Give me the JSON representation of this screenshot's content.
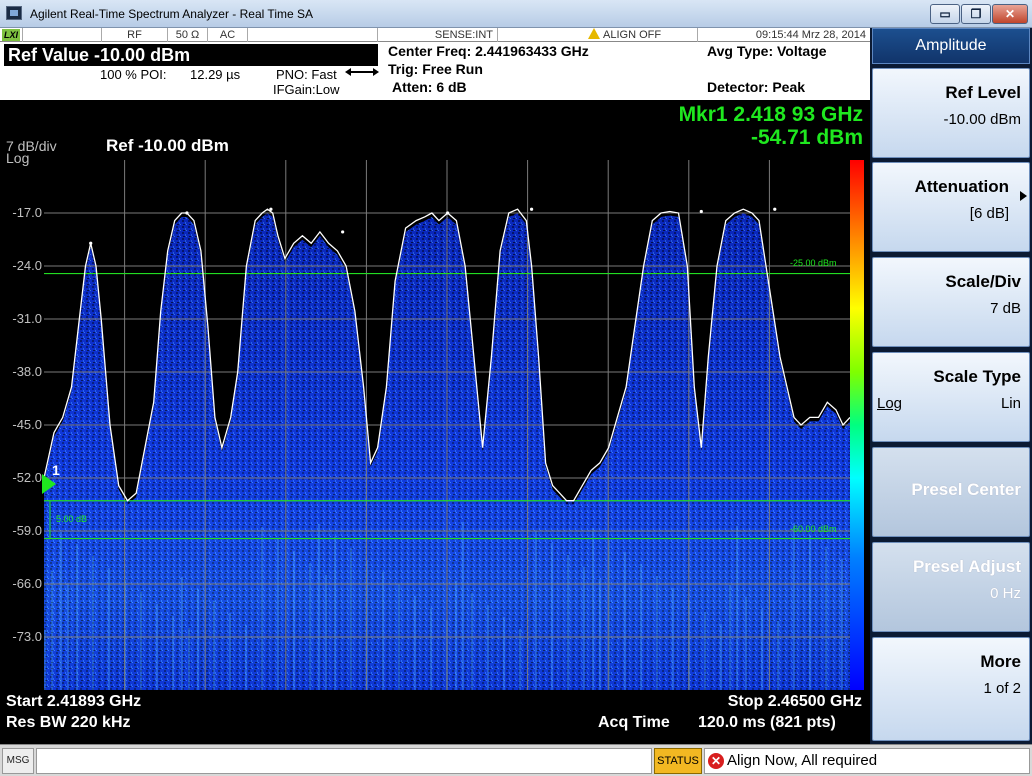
{
  "window": {
    "title": "Agilent Real-Time Spectrum Analyzer - Real Time SA",
    "min_glyph": "▭",
    "max_glyph": "❐",
    "close_glyph": "✕",
    "icon": "app-icon"
  },
  "status_row": {
    "lxi": "LXI",
    "rf": "RF",
    "impedance": "50 Ω",
    "coupling": "AC",
    "sense": "SENSE:INT",
    "align": "ALIGN OFF",
    "datetime": "09:15:44 Mrz 28, 2014"
  },
  "header": {
    "ref_value": "Ref Value -10.00 dBm",
    "poi_label": "100 % POI:",
    "poi_value": "12.29 µs",
    "pno": "PNO: Fast",
    "ifgain": "IFGain:Low",
    "center_freq": "Center Freq: 2.441963433 GHz",
    "trig": "Trig: Free Run",
    "atten": "Atten: 6 dB",
    "avg_type": "Avg Type: Voltage",
    "detector": "Detector: Peak"
  },
  "display": {
    "scale": "7 dB/div",
    "scale_type": "Log",
    "ref": "Ref -10.00 dBm",
    "marker_freq": "Mkr1 2.418 93 GHz",
    "marker_amp": "-54.71 dBm",
    "marker_label": "1",
    "y_labels": [
      "-17.0",
      "-24.0",
      "-31.0",
      "-38.0",
      "-45.0",
      "-52.0",
      "-59.0",
      "-66.0",
      "-73.0"
    ],
    "line_upper_label": "-25.00 dBm",
    "line_lower_label": "-60.00 dBm",
    "delta_label": "5.00 dB",
    "start": "Start 2.41893 GHz",
    "res_bw": "Res BW 220 kHz",
    "stop": "Stop 2.46500 GHz",
    "acq_label": "Acq Time",
    "acq_value": "120.0 ms (821 pts)"
  },
  "chart_data": {
    "type": "line",
    "xlabel": "",
    "ylabel": "",
    "xlim": [
      2.41893,
      2.465
    ],
    "ylim": [
      -80,
      -10
    ],
    "y_ticks": [
      -17,
      -24,
      -31,
      -38,
      -45,
      -52,
      -59,
      -66,
      -73
    ],
    "grid": true,
    "marker": {
      "x": 2.41893,
      "y": -54.71
    },
    "threshold_lines": [
      -25.0,
      -55.0,
      -60.0
    ],
    "peaks": [
      {
        "x": 2.4216,
        "y": -21.0
      },
      {
        "x": 2.4271,
        "y": -17.0
      },
      {
        "x": 2.4319,
        "y": -16.5
      },
      {
        "x": 2.436,
        "y": -19.5
      },
      {
        "x": 2.442,
        "y": -17.0
      },
      {
        "x": 2.4468,
        "y": -16.5
      },
      {
        "x": 2.4565,
        "y": -16.8
      },
      {
        "x": 2.4607,
        "y": -16.5
      }
    ],
    "trace": {
      "name": "",
      "x": [
        2.41893,
        2.4195,
        2.42,
        2.4205,
        2.421,
        2.4213,
        2.4216,
        2.4219,
        2.4222,
        2.4227,
        2.4232,
        2.4237,
        2.4242,
        2.4247,
        2.4252,
        2.4256,
        2.426,
        2.4264,
        2.4268,
        2.4271,
        2.4275,
        2.4279,
        2.4283,
        2.4287,
        2.4291,
        2.4296,
        2.43,
        2.4305,
        2.431,
        2.4314,
        2.4317,
        2.432,
        2.4323,
        2.4327,
        2.4332,
        2.4337,
        2.4342,
        2.4347,
        2.4352,
        2.4357,
        2.4362,
        2.4367,
        2.4372,
        2.4376,
        2.438,
        2.4385,
        2.439,
        2.4396,
        2.4402,
        2.4407,
        2.4411,
        2.4415,
        2.442,
        2.4425,
        2.443,
        2.4435,
        2.444,
        2.4445,
        2.445,
        2.4455,
        2.446,
        2.4465,
        2.4468,
        2.4472,
        2.4476,
        2.448,
        2.4484,
        2.4488,
        2.4492,
        2.4497,
        2.4502,
        2.4507,
        2.4512,
        2.4517,
        2.4522,
        2.4527,
        2.4532,
        2.4537,
        2.4542,
        2.4547,
        2.4552,
        2.4557,
        2.4561,
        2.4565,
        2.4569,
        2.4574,
        2.4579,
        2.4584,
        2.4589,
        2.4594,
        2.4598,
        2.4602,
        2.4606,
        2.461,
        2.4614,
        2.4618,
        2.4622,
        2.4627,
        2.4632,
        2.4637,
        2.4642,
        2.4646,
        2.465
      ],
      "y": [
        -52,
        -46,
        -44,
        -40,
        -30,
        -24,
        -21,
        -24,
        -31,
        -45,
        -53,
        -55,
        -54,
        -48,
        -42,
        -30,
        -22,
        -18,
        -17,
        -17,
        -18,
        -22,
        -32,
        -44,
        -48,
        -44,
        -38,
        -24,
        -18,
        -17,
        -16.5,
        -17,
        -20,
        -23,
        -21,
        -20,
        -21,
        -19.5,
        -21,
        -22,
        -24,
        -30,
        -40,
        -50,
        -48,
        -40,
        -26,
        -19,
        -18,
        -17.5,
        -17,
        -18,
        -17,
        -18,
        -24,
        -36,
        -48,
        -36,
        -22,
        -17,
        -16.5,
        -18,
        -24,
        -36,
        -50,
        -53,
        -54,
        -55,
        -55,
        -53,
        -51,
        -50,
        -48,
        -44,
        -40,
        -32,
        -24,
        -18,
        -17,
        -16.8,
        -17,
        -24,
        -40,
        -48,
        -36,
        -24,
        -18,
        -17,
        -16.5,
        -17,
        -18,
        -24,
        -30,
        -36,
        -40,
        -44,
        -45,
        -44,
        -44,
        -42,
        -43,
        -45,
        -44
      ]
    }
  },
  "softkeys": {
    "header": "Amplitude",
    "items": [
      {
        "label": "Ref Level",
        "value": "-10.00 dBm"
      },
      {
        "label": "Attenuation",
        "value": "[6 dB]"
      },
      {
        "label": "Scale/Div",
        "value": "7 dB"
      },
      {
        "label": "Scale Type",
        "left": "Log",
        "value": "Lin"
      },
      {
        "label": "Presel Center",
        "value": ""
      },
      {
        "label": "Presel Adjust",
        "value": "0 Hz"
      },
      {
        "label": "More",
        "value": "1 of 2"
      }
    ]
  },
  "message_bar": {
    "msg_label": "MSG",
    "status_label": "STATUS",
    "error_glyph": "✕",
    "alert": "Align Now, All required"
  },
  "colors": {
    "grid": "#7a7a7a",
    "trace": "#ffffff",
    "limit_line": "#22dd22",
    "accent": "#1fe81f",
    "softkey_bg": "#dfe9f6"
  }
}
